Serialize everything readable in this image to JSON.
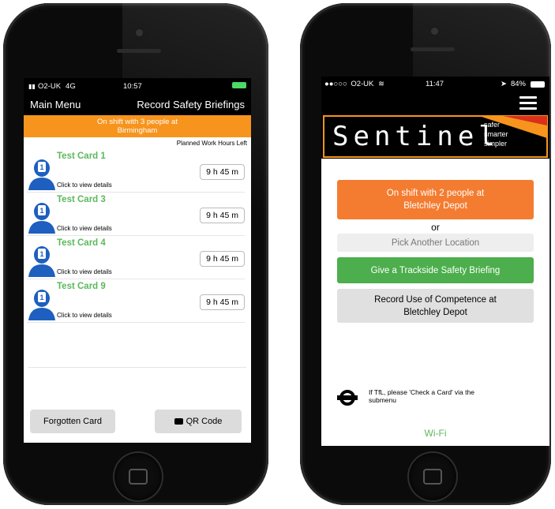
{
  "left_phone": {
    "status": {
      "carrier": "O2-UK",
      "network": "4G",
      "time": "10:57"
    },
    "nav": {
      "menu_label": "Main Menu",
      "title": "Record Safety Briefings"
    },
    "banner": {
      "line1": "On shift with 3 people at",
      "line2": "Birmingham"
    },
    "hours_header": "Planned Work Hours Left",
    "cards": [
      {
        "name": "Test Card 1",
        "subtitle": "Click to view details",
        "hours": "9 h 45 m"
      },
      {
        "name": "Test Card 3",
        "subtitle": "Click to view details",
        "hours": "9 h 45 m"
      },
      {
        "name": "Test Card 4",
        "subtitle": "Click to view details",
        "hours": "9 h 45 m"
      },
      {
        "name": "Test Card 9",
        "subtitle": "Click to view details",
        "hours": "9 h 45 m"
      }
    ],
    "footer": {
      "forgotten": "Forgotten Card",
      "qr": "QR Code"
    }
  },
  "right_phone": {
    "status": {
      "carrier": "O2-UK",
      "time": "11:47",
      "battery": "84%"
    },
    "logo": {
      "name": "Sentinel",
      "tag1": "safer",
      "tag2": "smarter",
      "tag3": "simpler"
    },
    "shift_button": {
      "line1": "On shift with 2 people at",
      "line2": "Bletchley Depot"
    },
    "or_label": "or",
    "pick_location": "Pick Another Location",
    "give_briefing": "Give a Trackside Safety Briefing",
    "record_competence": {
      "line1": "Record Use of Competence at",
      "line2": "Bletchley Depot"
    },
    "tfl_note": {
      "line1": "If TfL, please 'Check a Card' via the",
      "line2": "submenu"
    },
    "wifi": "Wi-Fi"
  },
  "colors": {
    "orange": "#f7941d",
    "green": "#4cae4c",
    "grey_button": "#e0e0e0",
    "card_name": "#5cb85c"
  }
}
